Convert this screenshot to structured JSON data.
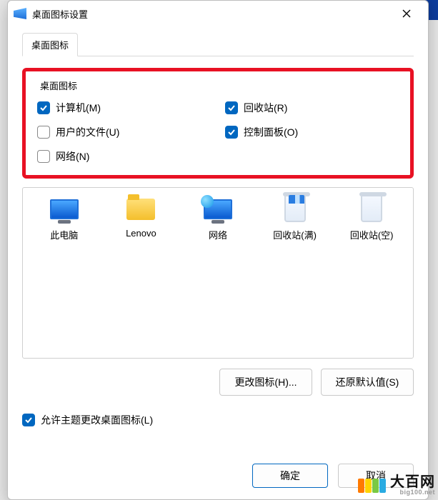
{
  "dialog": {
    "title": "桌面图标设置",
    "tab": "桌面图标",
    "group_label": "桌面图标",
    "checks": [
      {
        "key": "computer",
        "label": "计算机(M)",
        "checked": true
      },
      {
        "key": "recycle",
        "label": "回收站(R)",
        "checked": true
      },
      {
        "key": "userfiles",
        "label": "用户的文件(U)",
        "checked": false
      },
      {
        "key": "control",
        "label": "控制面板(O)",
        "checked": true
      },
      {
        "key": "network",
        "label": "网络(N)",
        "checked": false
      }
    ],
    "preview": [
      {
        "key": "thispc",
        "label": "此电脑"
      },
      {
        "key": "lenovo",
        "label": "Lenovo"
      },
      {
        "key": "net",
        "label": "网络"
      },
      {
        "key": "binfull",
        "label": "回收站(满)"
      },
      {
        "key": "binempty",
        "label": "回收站(空)"
      }
    ],
    "buttons": {
      "change_icon": "更改图标(H)...",
      "restore_default": "还原默认值(S)"
    },
    "allow_theme": {
      "label": "允许主题更改桌面图标(L)",
      "checked": true
    },
    "footer": {
      "ok": "确定",
      "cancel": "取消"
    }
  },
  "watermark": {
    "text": "大百网",
    "sub": "big100.net",
    "colors": [
      "#ff7a00",
      "#ffd400",
      "#7ac943",
      "#29abe2"
    ]
  }
}
